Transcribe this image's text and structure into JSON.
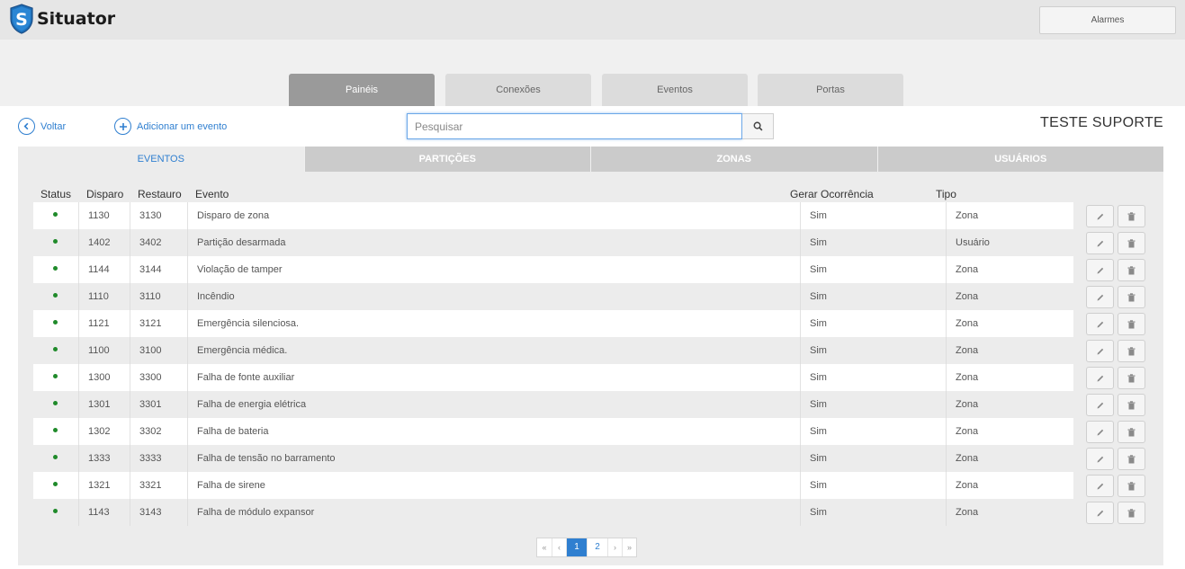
{
  "app": {
    "name": "Situator",
    "logo_letter": "S",
    "alarm_button": "Alarmes"
  },
  "main_tabs": [
    {
      "label": "Painéis",
      "active": true
    },
    {
      "label": "Conexões",
      "active": false
    },
    {
      "label": "Eventos",
      "active": false
    },
    {
      "label": "Portas",
      "active": false
    }
  ],
  "toolbar": {
    "back_label": "Voltar",
    "add_label": "Adicionar um evento",
    "search_placeholder": "Pesquisar",
    "panel_name": "TESTE SUPORTE"
  },
  "sub_tabs": [
    {
      "label": "EVENTOS",
      "active": true
    },
    {
      "label": "PARTIÇÕES",
      "active": false
    },
    {
      "label": "ZONAS",
      "active": false
    },
    {
      "label": "USUÁRIOS",
      "active": false
    }
  ],
  "table": {
    "headers": {
      "status": "Status",
      "disparo": "Disparo",
      "restauro": "Restauro",
      "evento": "Evento",
      "gerar": "Gerar Ocorrência",
      "tipo": "Tipo"
    },
    "rows": [
      {
        "disparo": "1130",
        "restauro": "3130",
        "evento": "Disparo de zona",
        "gerar": "Sim",
        "tipo": "Zona"
      },
      {
        "disparo": "1402",
        "restauro": "3402",
        "evento": "Partição desarmada",
        "gerar": "Sim",
        "tipo": "Usuário"
      },
      {
        "disparo": "1144",
        "restauro": "3144",
        "evento": "Violação de tamper",
        "gerar": "Sim",
        "tipo": "Zona"
      },
      {
        "disparo": "1110",
        "restauro": "3110",
        "evento": "Incêndio",
        "gerar": "Sim",
        "tipo": "Zona"
      },
      {
        "disparo": "1121",
        "restauro": "3121",
        "evento": "Emergência silenciosa.",
        "gerar": "Sim",
        "tipo": "Zona"
      },
      {
        "disparo": "1100",
        "restauro": "3100",
        "evento": "Emergência médica.",
        "gerar": "Sim",
        "tipo": "Zona"
      },
      {
        "disparo": "1300",
        "restauro": "3300",
        "evento": "Falha de fonte auxiliar",
        "gerar": "Sim",
        "tipo": "Zona"
      },
      {
        "disparo": "1301",
        "restauro": "3301",
        "evento": "Falha de energia elétrica",
        "gerar": "Sim",
        "tipo": "Zona"
      },
      {
        "disparo": "1302",
        "restauro": "3302",
        "evento": "Falha de bateria",
        "gerar": "Sim",
        "tipo": "Zona"
      },
      {
        "disparo": "1333",
        "restauro": "3333",
        "evento": "Falha de tensão no barramento",
        "gerar": "Sim",
        "tipo": "Zona"
      },
      {
        "disparo": "1321",
        "restauro": "3321",
        "evento": "Falha de sirene",
        "gerar": "Sim",
        "tipo": "Zona"
      },
      {
        "disparo": "1143",
        "restauro": "3143",
        "evento": "Falha de módulo expansor",
        "gerar": "Sim",
        "tipo": "Zona"
      }
    ]
  },
  "pagination": {
    "first": "«",
    "prev": "‹",
    "pages": [
      "1",
      "2"
    ],
    "current": "1",
    "next": "›",
    "last": "»"
  },
  "colors": {
    "accent": "#2f7fd0",
    "status_active": "#1f8a2a",
    "tab_active": "#9a9a9a"
  },
  "icons": {
    "back": "chevron-left-circle-icon",
    "add": "plus-circle-icon",
    "search": "search-icon",
    "edit": "pencil-icon",
    "delete": "trash-icon"
  }
}
